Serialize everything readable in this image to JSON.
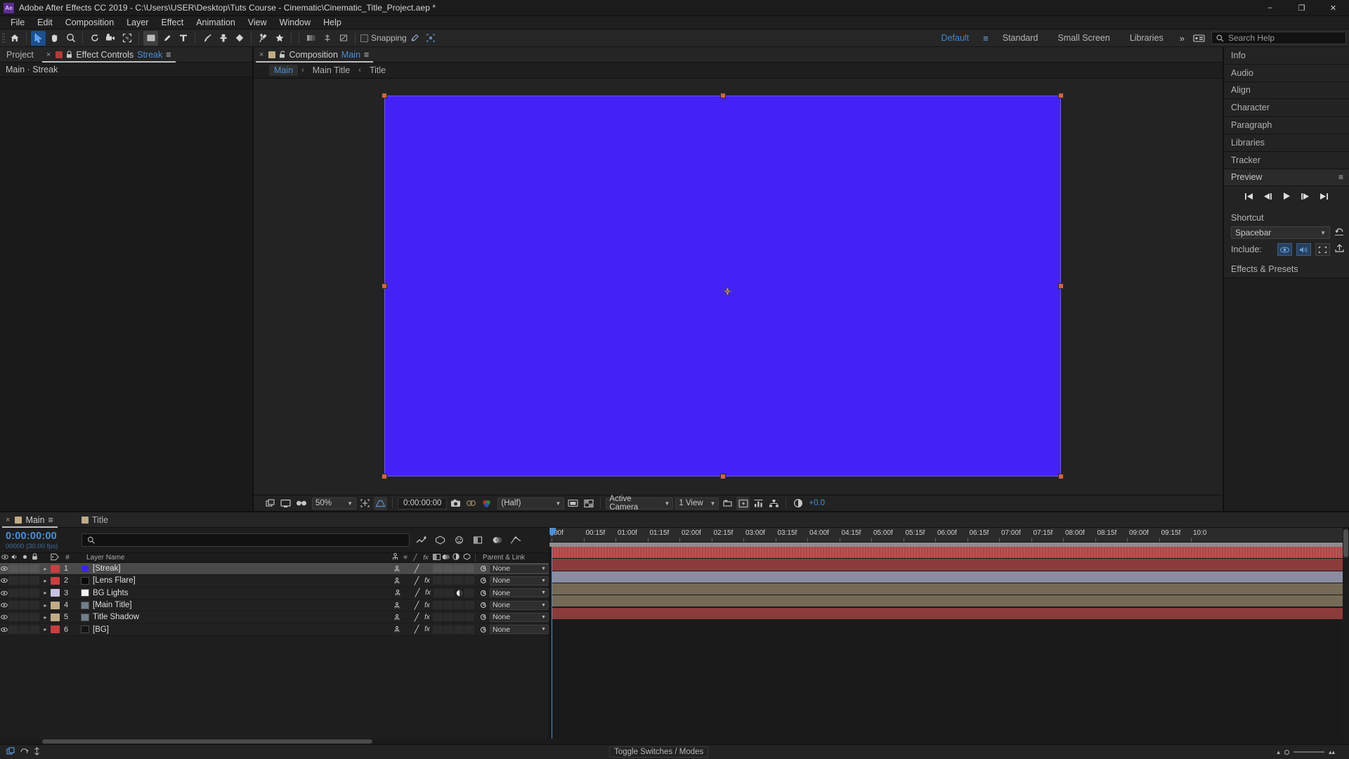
{
  "titlebar": {
    "logo": "Ae",
    "title": "Adobe After Effects CC 2019 - C:\\Users\\USER\\Desktop\\Tuts Course - Cinematic\\Cinematic_Title_Project.aep *",
    "minimize": "–",
    "maximize": "❐",
    "close": "✕"
  },
  "menubar": {
    "items": [
      "File",
      "Edit",
      "Composition",
      "Layer",
      "Effect",
      "Animation",
      "View",
      "Window",
      "Help"
    ]
  },
  "toolbar": {
    "tools": [
      {
        "name": "home-icon",
        "glyph": "⌂"
      },
      {
        "name": "selection-tool",
        "glyph": "➤"
      },
      {
        "name": "hand-tool",
        "glyph": "✋"
      },
      {
        "name": "zoom-tool",
        "glyph": "⌕"
      },
      {
        "name": "rotation-tool",
        "glyph": "↺"
      },
      {
        "name": "camera-tool",
        "glyph": "◰"
      },
      {
        "name": "pan-behind-tool",
        "glyph": "✥"
      },
      {
        "name": "shape-tool",
        "glyph": "■"
      },
      {
        "name": "pen-tool",
        "glyph": "✒"
      },
      {
        "name": "type-tool",
        "glyph": "T"
      },
      {
        "name": "brush-tool",
        "glyph": "╱"
      },
      {
        "name": "clone-stamp-tool",
        "glyph": "⚓"
      },
      {
        "name": "eraser-tool",
        "glyph": "◆"
      },
      {
        "name": "roto-brush-tool",
        "glyph": "⚘"
      },
      {
        "name": "puppet-pin-tool",
        "glyph": "✦"
      }
    ],
    "extra_tools": [
      {
        "name": "gradient-icon",
        "glyph": "▤"
      },
      {
        "name": "align-icon",
        "glyph": "↕"
      },
      {
        "name": "mask-icon",
        "glyph": "◱"
      }
    ],
    "snapping_label": "Snapping",
    "snapping_checked": false,
    "workspaces": [
      {
        "label": "Default",
        "active": true
      },
      {
        "label": "Standard",
        "active": false
      },
      {
        "label": "Small Screen",
        "active": false
      },
      {
        "label": "Libraries",
        "active": false
      }
    ],
    "workspace_menu_icon": "≡",
    "more_workspaces": "»",
    "adobe_account_icon": "⌗",
    "search_help_placeholder": "Search Help",
    "search_icon": "⚲"
  },
  "left_panel": {
    "tabs": [
      {
        "label": "Project",
        "active": false,
        "swatch": null
      },
      {
        "label": "Effect Controls",
        "highlight": "Streak",
        "active": true,
        "swatch": "#b33a3a"
      }
    ],
    "close_glyph": "×",
    "lock_glyph": "🔒",
    "menu_glyph": "≡",
    "subtitle": "Main · Streak"
  },
  "comp_panel": {
    "tab": {
      "close_glyph": "×",
      "swatch": "#c0ab86",
      "lock_glyph": "🔓",
      "label": "Composition",
      "name": "Main",
      "menu_glyph": "≡"
    },
    "breadcrumb": [
      {
        "label": "Main",
        "current": true
      },
      {
        "label": "Main Title",
        "current": false
      },
      {
        "label": "Title",
        "current": false
      }
    ],
    "breadcrumb_sep": "‹",
    "stage_color": "#4422F7",
    "bottom_bar": {
      "zoom": "50%",
      "timecode": "0:00:00:00",
      "resolution": "(Half)",
      "view": "Active Camera",
      "view_layout": "1 View",
      "exposure": "+0.0",
      "icons": [
        {
          "name": "always-preview-icon",
          "glyph": "⧉"
        },
        {
          "name": "main-viewer-icon",
          "glyph": "▭"
        },
        {
          "name": "3d-glasses-icon",
          "glyph": "◑"
        },
        {
          "name": "region-of-interest-icon",
          "glyph": "⧈"
        },
        {
          "name": "transparency-grid-icon",
          "glyph": "◱"
        },
        {
          "name": "take-snapshot-icon",
          "glyph": "▣"
        },
        {
          "name": "show-snapshot-icon",
          "glyph": "⚭"
        },
        {
          "name": "channel-rgb-icon",
          "glyph": "◉"
        },
        {
          "name": "toggle-mask-icon",
          "glyph": "▣"
        },
        {
          "name": "toggle-alpha-icon",
          "glyph": "⬚"
        },
        {
          "name": "grid-guides-icon",
          "glyph": "⬒"
        },
        {
          "name": "timeline-ref-icon",
          "glyph": "⚡"
        },
        {
          "name": "3d-renderer-icon",
          "glyph": "☰"
        },
        {
          "name": "comp-flowchart-icon",
          "glyph": "⛓"
        },
        {
          "name": "exposure-icon",
          "glyph": "◔"
        }
      ]
    }
  },
  "right_panel": {
    "items": [
      "Info",
      "Audio",
      "Align",
      "Character",
      "Paragraph",
      "Libraries",
      "Tracker"
    ],
    "preview": {
      "title": "Preview",
      "menu_glyph": "≡",
      "controls": [
        {
          "name": "first-frame-button",
          "glyph": "⏮"
        },
        {
          "name": "previous-frame-button",
          "glyph": "⏴"
        },
        {
          "name": "play-button",
          "glyph": "▶"
        },
        {
          "name": "next-frame-button",
          "glyph": "⏵"
        },
        {
          "name": "last-frame-button",
          "glyph": "⏭"
        }
      ],
      "shortcut_label": "Shortcut",
      "shortcut_value": "Spacebar",
      "reset_glyph": "↺",
      "include_label": "Include:",
      "include_buttons": [
        {
          "name": "include-video-icon",
          "glyph": "◉",
          "on": true
        },
        {
          "name": "include-audio-icon",
          "glyph": "🔊",
          "on": true
        },
        {
          "name": "include-overlays-icon",
          "glyph": "⧈",
          "on": true
        }
      ],
      "export_glyph": "⤴"
    },
    "effects_presets": "Effects & Presets"
  },
  "timeline": {
    "tabs": [
      {
        "label": "Main",
        "active": true,
        "swatch": "#c0ab86"
      },
      {
        "label": "Title",
        "active": false,
        "swatch": "#c0ab86"
      }
    ],
    "close_glyph": "×",
    "menu_glyph": "≡",
    "current_time": "0:00:00:00",
    "frame_info": "00000 (30.00 fps)",
    "search_placeholder": "",
    "search_icon": "⚲",
    "header_icons": [
      {
        "name": "composition-mini-flowchart-icon",
        "glyph": "⌕"
      },
      {
        "name": "draft-3d-icon",
        "glyph": "◎"
      },
      {
        "name": "hide-shy-layers-icon",
        "glyph": "☺"
      },
      {
        "name": "frame-blending-icon",
        "glyph": "◧"
      },
      {
        "name": "motion-blur-icon",
        "glyph": "◕"
      },
      {
        "name": "graph-editor-icon",
        "glyph": "⧋"
      }
    ],
    "columns": {
      "av_icons": [
        "◉",
        "◈",
        "●",
        "🔒"
      ],
      "label_icon": "🏷",
      "number": "#",
      "layer_name": "Layer Name",
      "switch_icons": [
        "⚓",
        "✳",
        "╲",
        "fx",
        "▣",
        "◑",
        "◐",
        "⬡"
      ],
      "parent_link": "Parent & Link"
    },
    "layers": [
      {
        "num": "1",
        "name": "[Streak]",
        "color": "#c64040",
        "thumb": "#3b24e8",
        "selected": true,
        "fx": false,
        "mask": false,
        "bar": "#b54a4a",
        "bar_type": "solid-textured"
      },
      {
        "num": "2",
        "name": "[Lens Flare]",
        "color": "#c64040",
        "thumb": "#0a0a0a",
        "selected": false,
        "fx": true,
        "mask": false,
        "bar": "#8c3b3b",
        "bar_type": "solid"
      },
      {
        "num": "3",
        "name": "BG Lights",
        "color": "#c8c2e0",
        "thumb": "#f2f2f2",
        "selected": false,
        "fx": true,
        "mask": true,
        "bar": "#8c8ca0",
        "bar_type": "solid"
      },
      {
        "num": "4",
        "name": "[Main Title]",
        "color": "#c0ab86",
        "thumb": "#6f7f8f",
        "selected": false,
        "fx": true,
        "mask": false,
        "bar": "#756a56",
        "bar_type": "solid"
      },
      {
        "num": "5",
        "name": "Title Shadow",
        "color": "#c0ab86",
        "thumb": "#6f7f8f",
        "selected": false,
        "fx": true,
        "mask": false,
        "bar": "#756a56",
        "bar_type": "solid"
      },
      {
        "num": "6",
        "name": "[BG]",
        "color": "#c64040",
        "thumb": "#141414",
        "selected": false,
        "fx": true,
        "mask": false,
        "bar": "#8c3b3b",
        "bar_type": "solid"
      }
    ],
    "parent_value": "None",
    "ruler_ticks": [
      "00f",
      "00:15f",
      "01:00f",
      "01:15f",
      "02:00f",
      "02:15f",
      "03:00f",
      "03:15f",
      "04:00f",
      "04:15f",
      "05:00f",
      "05:15f",
      "06:00f",
      "06:15f",
      "07:00f",
      "07:15f",
      "08:00f",
      "08:15f",
      "09:00f",
      "09:15f",
      "10:0"
    ],
    "footer": {
      "toggle_label": "Toggle Switches / Modes",
      "icons": [
        {
          "name": "toggle-switches-icon",
          "glyph": "⧉"
        },
        {
          "name": "motion-blur-footer-icon",
          "glyph": "↻"
        },
        {
          "name": "graph-editor-footer-icon",
          "glyph": "⫼"
        }
      ],
      "zoom_out_glyph": "▴",
      "zoom_in_glyph": "▴▴"
    }
  },
  "colors": {
    "accent_blue": "#4b8fd4",
    "comp_blue": "#4422F7",
    "handle_orange": "#cf6445",
    "selection_gray": "#4a4a4a"
  }
}
